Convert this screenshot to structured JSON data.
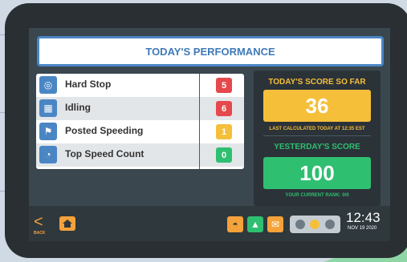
{
  "header": {
    "title": "TODAY'S PERFORMANCE"
  },
  "metrics": [
    {
      "label": "Hard Stop",
      "value": "5",
      "color": "#e5484d",
      "icon": "steering-wheel-icon"
    },
    {
      "label": "Idling",
      "value": "6",
      "color": "#e5484d",
      "icon": "engine-icon"
    },
    {
      "label": "Posted Speeding",
      "value": "1",
      "color": "#f5bf3a",
      "icon": "speed-sign-icon"
    },
    {
      "label": "Top Speed Count",
      "value": "0",
      "color": "#2fbf71",
      "icon": "speedometer-icon"
    }
  ],
  "score": {
    "today_title": "TODAY'S SCORE SO FAR",
    "today_value": "36",
    "today_color": "#f5bf3a",
    "last_calculated": "LAST CALCULATED TODAY AT 12:35 EST",
    "yesterday_title": "YESTERDAY'S SCORE",
    "yesterday_value": "100",
    "yesterday_color": "#2fbf71",
    "rank": "YOUR CURRENT RANK: 0/0"
  },
  "footer": {
    "back_label": "BACK",
    "time": "12:43",
    "date": "NOV 19 2020",
    "home_icon": "home-icon",
    "app_icons": [
      "gauge-icon",
      "triangle-icon",
      "mail-icon"
    ],
    "status_dots": [
      "#6f7b84",
      "#f5bf3a",
      "#6f7b84"
    ]
  },
  "brand": {
    "accent": "#4a86c4",
    "orange": "#f5a23a"
  }
}
